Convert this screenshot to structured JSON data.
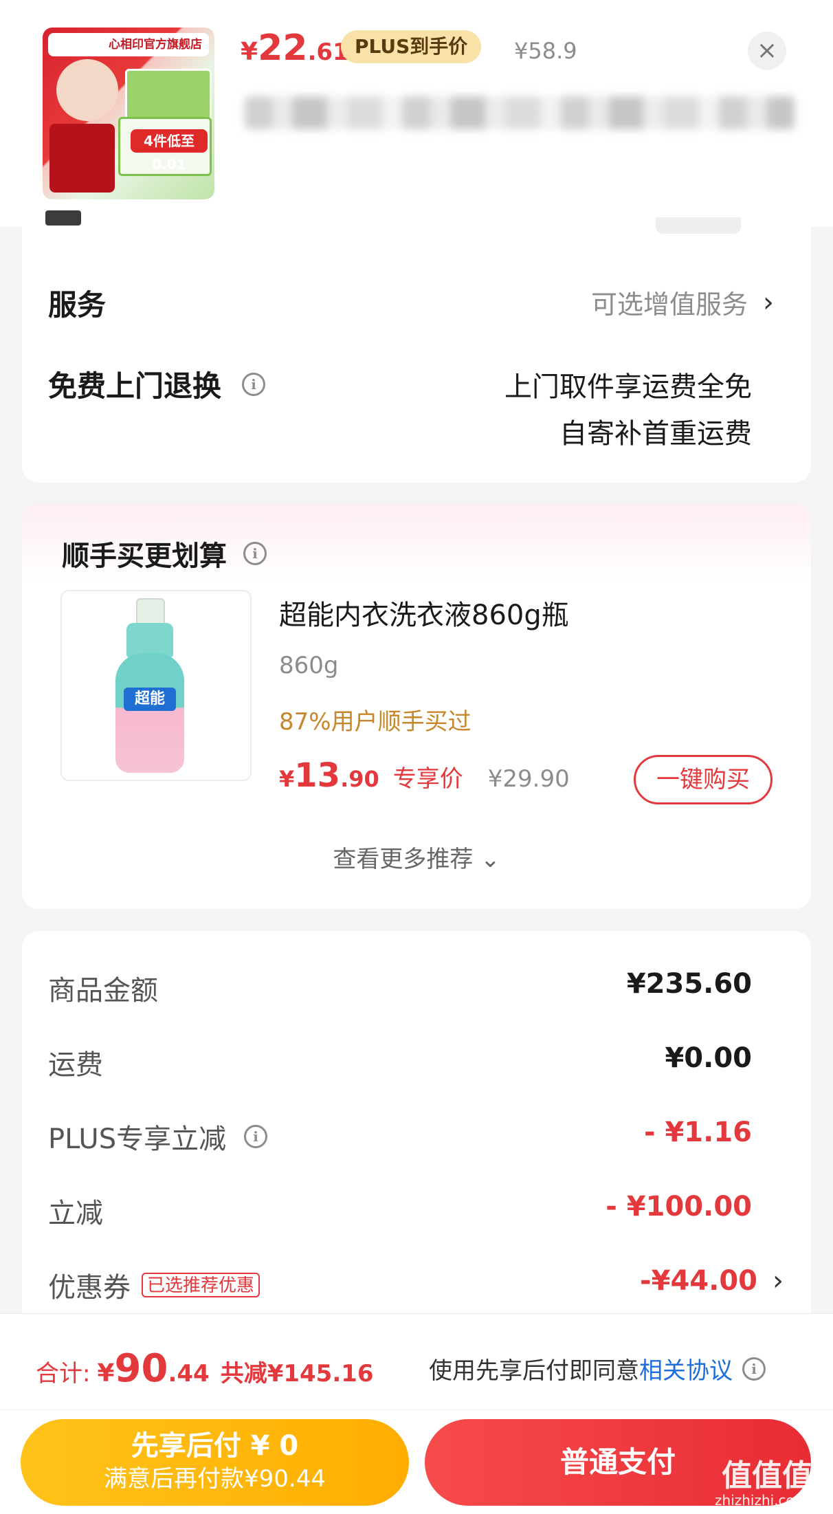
{
  "header": {
    "thumb_brand": "心相印官方旗舰店",
    "thumb_promo": "4件低至0.01",
    "price_currency": "¥",
    "price_int": "22",
    "price_dec": ".61",
    "plus_label": "PLUS到手价",
    "original_price": "¥58.9",
    "close_glyph": "×"
  },
  "service": {
    "label": "服务",
    "value": "可选增值服务",
    "chevron": "›"
  },
  "return_service": {
    "label": "免费上门退换",
    "line1": "上门取件享运费全免",
    "line2": "自寄补首重运费"
  },
  "recommend": {
    "title": "顺手买更划算",
    "product": {
      "image_label": "超能",
      "name": "超能内衣洗衣液860g瓶",
      "spec": "860g",
      "bought": "87%用户顺手买过",
      "price_currency": "¥",
      "price_int": "13",
      "price_dec": ".90",
      "price_label": "专享价",
      "orig_price": "¥29.90",
      "buy_button": "一键购买"
    },
    "more": "查看更多推荐 ⌄"
  },
  "summary": {
    "rows": [
      {
        "label": "商品金额",
        "value": "¥235.60"
      },
      {
        "label": "运费",
        "value": "¥0.00"
      },
      {
        "label": "PLUS专享立减",
        "value": "- ¥1.16"
      },
      {
        "label": "立减",
        "value": "- ¥100.00"
      },
      {
        "label": "优惠券",
        "tag": "已选推荐优惠",
        "value": "-¥44.00"
      }
    ]
  },
  "bottom": {
    "total_label": "合计:",
    "total_currency": "¥",
    "total_int": "90",
    "total_dec": ".44",
    "total_saved": "共减¥145.16",
    "agree_text": "使用先享后付即同意",
    "agree_link": "相关协议",
    "later_line1": "先享后付 ¥ 0",
    "later_line2": "满意后再付款¥90.44",
    "pay_button": "普通支付",
    "watermark": "值值值",
    "watermark_url": "zhizhizhi.com"
  },
  "colors": {
    "accent_red": "#e4393c",
    "plus_gold": "#f9e2a7",
    "link_blue": "#1f6fd8",
    "later_yellow": "#ffae00"
  }
}
